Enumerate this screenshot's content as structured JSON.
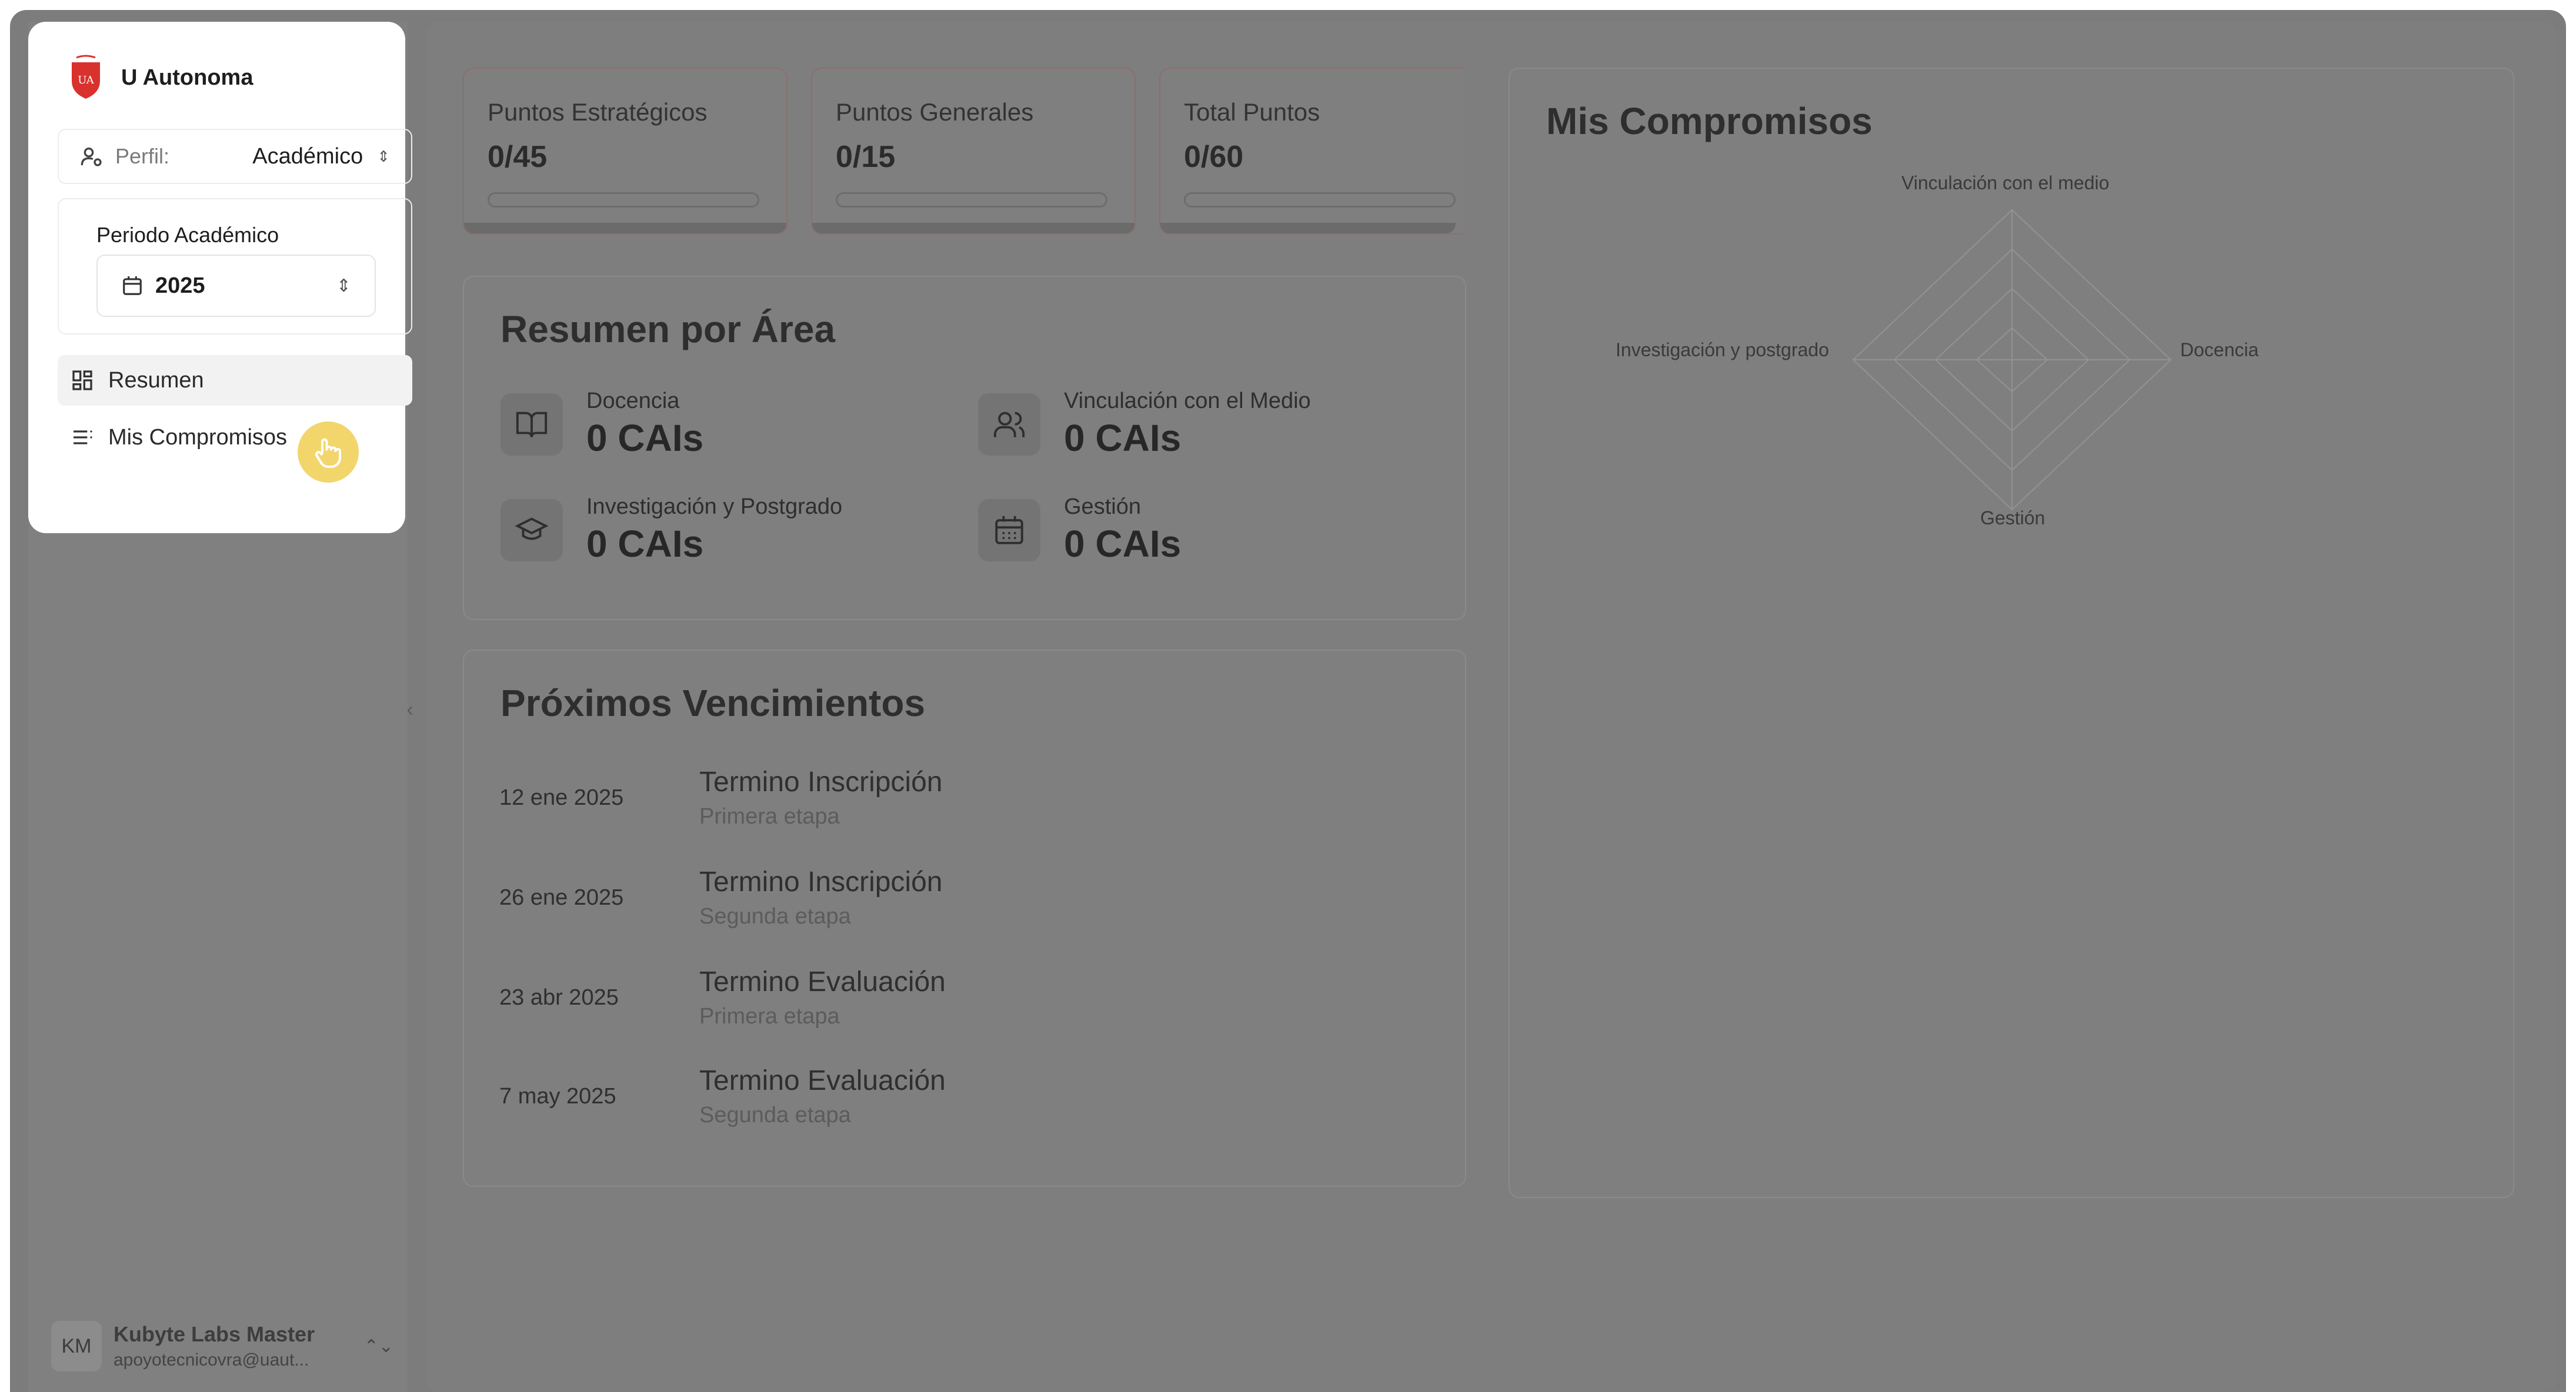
{
  "sidebar": {
    "brand": "U Autonoma",
    "logo_text": "UA",
    "profile_label": "Perfil:",
    "profile_value": "Académico",
    "period_title": "Periodo Académico",
    "period_year": "2025",
    "nav": [
      {
        "label": "Resumen",
        "active": true
      },
      {
        "label": "Mis Compromisos",
        "active": false
      }
    ],
    "user": {
      "initials": "KM",
      "name": "Kubyte Labs Master",
      "email": "apoyotecnicovra@uaut..."
    }
  },
  "kpis": [
    {
      "title": "Puntos Estratégicos",
      "value": "0/45",
      "progress": 0
    },
    {
      "title": "Puntos Generales",
      "value": "0/15",
      "progress": 0
    },
    {
      "title": "Total Puntos",
      "value": "0/60",
      "progress": 0
    }
  ],
  "summary": {
    "title": "Resumen por Área",
    "areas": [
      {
        "name": "Docencia",
        "value": "0 CAIs",
        "icon": "book-icon"
      },
      {
        "name": "Vinculación con el Medio",
        "value": "0 CAIs",
        "icon": "users-icon"
      },
      {
        "name": "Investigación y Postgrado",
        "value": "0 CAIs",
        "icon": "graduation-cap-icon"
      },
      {
        "name": "Gestión",
        "value": "0 CAIs",
        "icon": "calendar-icon"
      }
    ]
  },
  "deadlines": {
    "title": "Próximos Vencimientos",
    "items": [
      {
        "date": "12 ene 2025",
        "title": "Termino Inscripción",
        "subtitle": "Primera etapa"
      },
      {
        "date": "26 ene 2025",
        "title": "Termino Inscripción",
        "subtitle": "Segunda etapa"
      },
      {
        "date": "23 abr 2025",
        "title": "Termino Evaluación",
        "subtitle": "Primera etapa"
      },
      {
        "date": "7 may 2025",
        "title": "Termino Evaluación",
        "subtitle": "Segunda etapa"
      }
    ]
  },
  "commitments": {
    "title": "Mis Compromisos",
    "radar_axes": [
      "Vinculación con el medio",
      "Docencia",
      "Gestión",
      "Investigación y postgrado"
    ]
  },
  "colors": {
    "accent": "#d9312b",
    "cursor": "#f2d66b",
    "overlay": "#7e7e7e"
  }
}
